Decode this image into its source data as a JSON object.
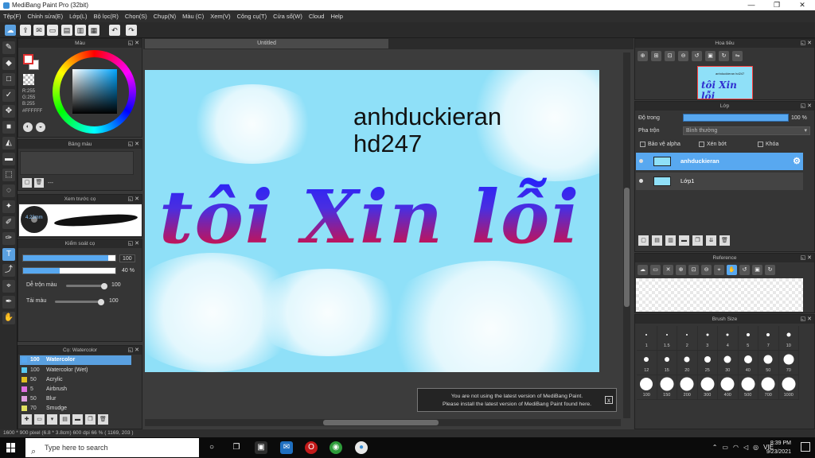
{
  "window": {
    "title": "MediBang Paint Pro (32bit)",
    "minimize": "—",
    "restore": "❐",
    "close": "✕"
  },
  "menu": [
    "Tệp(F)",
    "Chỉnh sửa(E)",
    "Lớp(L)",
    "Bộ lọc(R)",
    "Chọn(S)",
    "Chụp(N)",
    "Màu (C)",
    "Xem(V)",
    "Công cụ(T)",
    "Cửa sổ(W)",
    "Cloud",
    "Help"
  ],
  "toolbar": {
    "undo_icon": "↶",
    "redo_icon": "↷"
  },
  "color_panel": {
    "title": "Màu",
    "r": "R:255",
    "g": "G:255",
    "b": "B:255",
    "hex": "#FFFFFF"
  },
  "palette_panel": {
    "title": "Bảng màu",
    "dash": "---"
  },
  "preview_panel": {
    "title": "Xem trước cọ",
    "size": "4.23mm"
  },
  "control_panel": {
    "title": "Kiểm soát cọ",
    "size_value": "100",
    "opacity_value": "40 %",
    "blend_label": "Dễ trộn màu",
    "blend_value": "100",
    "paint_label": "Tải màu",
    "paint_value": "100",
    "size_level": 0.92,
    "opacity_level": 0.4
  },
  "brush_panel": {
    "title": "Cọ: Watercolor",
    "items": [
      {
        "size": "100",
        "name": "Watercolor",
        "color": "#58a8f0"
      },
      {
        "size": "100",
        "name": "Watercolor (Wet)",
        "color": "#58c8f0"
      },
      {
        "size": "50",
        "name": "Acrylic",
        "color": "#e0c020"
      },
      {
        "size": "5",
        "name": "Airbrush",
        "color": "#e070e0"
      },
      {
        "size": "50",
        "name": "Blur",
        "color": "#e0a0e0"
      },
      {
        "size": "70",
        "name": "Smudge",
        "color": "#e0e060"
      }
    ]
  },
  "document": {
    "tab": "Untitled",
    "text_line1": "anhduckieran",
    "text_line2": "hd247",
    "script_text": "tôi Xin lỗi",
    "canvas_color": "#8fe0f8"
  },
  "notice": {
    "line1": "You are not using the latest version of MediBang Paint.",
    "line2": "Please install the latest version of MediBang Paint found here.",
    "close": "x"
  },
  "navigator": {
    "title": "Hoa tiêu",
    "thumb_text": "tôi Xin lỗi",
    "thumb_small": "anhduckieran hd247"
  },
  "layer_panel": {
    "title": "Lớp",
    "opacity_label": "Độ trong",
    "opacity_value": "100 %",
    "blend_label": "Pha trộn",
    "blend_value": "Bình thường",
    "protect_alpha": "Bảo vệ alpha",
    "clipping": "Xén bớt",
    "lock": "Khóa",
    "layers": [
      {
        "name": "anhduckieran",
        "selected": true
      },
      {
        "name": "Lớp1",
        "selected": false
      }
    ]
  },
  "reference_panel": {
    "title": "Reference"
  },
  "brush_size_panel": {
    "title": "Brush Size",
    "sizes": [
      "1",
      "1.5",
      "2",
      "3",
      "4",
      "5",
      "7",
      "10",
      "12",
      "15",
      "20",
      "25",
      "30",
      "40",
      "50",
      "70",
      "100",
      "150",
      "200",
      "300",
      "400",
      "500",
      "700",
      "1000"
    ]
  },
  "status_bar": {
    "text": "1600 * 900 pixel   (6.8 * 3.8cm)   600 dpi   66 %   ( 1169, 203 )"
  },
  "taskbar": {
    "search_placeholder": "Type here to search",
    "lang": "VIE",
    "time": "8:39 PM",
    "date": "9/23/2021"
  }
}
